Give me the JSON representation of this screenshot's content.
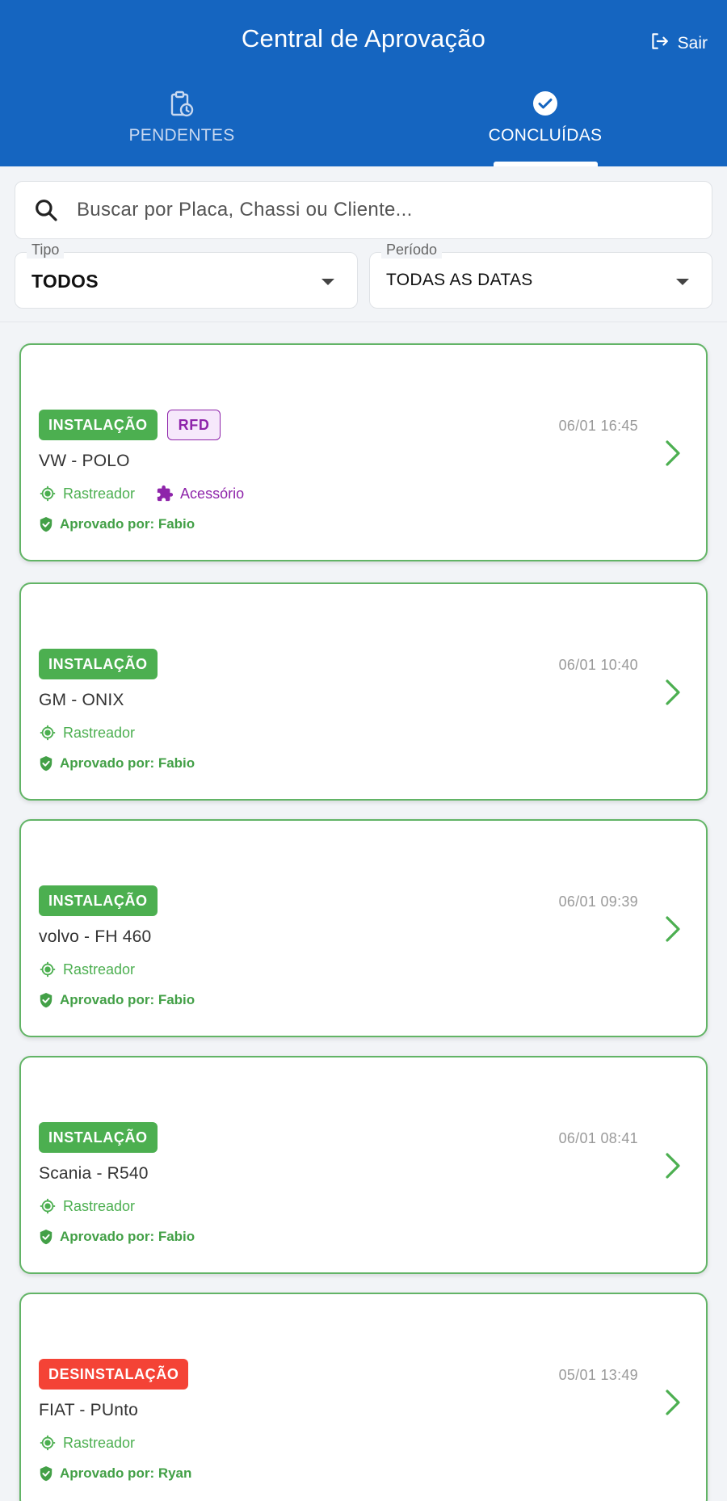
{
  "header": {
    "title": "Central de Aprovação",
    "logout_label": "Sair",
    "accent_color": "#1565c0"
  },
  "tabs": [
    {
      "label": "PENDENTES",
      "icon": "clipboard-clock-icon",
      "active": false
    },
    {
      "label": "CONCLUÍDAS",
      "icon": "check-circle-icon",
      "active": true
    }
  ],
  "search": {
    "placeholder": "Buscar por Placa, Chassi ou Cliente..."
  },
  "filters": {
    "tipo": {
      "label": "Tipo",
      "value": "TODOS"
    },
    "periodo": {
      "label": "Período",
      "value": "TODAS AS DATAS"
    }
  },
  "cards": [
    {
      "type": "INSTALAÇÃO",
      "extra_badge": "RFD",
      "date": "06/01 16:45",
      "vehicle": "VW - POLO",
      "tracker": "Rastreador",
      "accessory": "Acessório",
      "approved": "Aprovado por: Fabio"
    },
    {
      "type": "INSTALAÇÃO",
      "date": "06/01 10:40",
      "vehicle": "GM - ONIX",
      "tracker": "Rastreador",
      "approved": "Aprovado por: Fabio"
    },
    {
      "type": "INSTALAÇÃO",
      "date": "06/01 09:39",
      "vehicle": "volvo - FH 460",
      "tracker": "Rastreador",
      "approved": "Aprovado por: Fabio"
    },
    {
      "type": "INSTALAÇÃO",
      "date": "06/01 08:41",
      "vehicle": "Scania - R540",
      "tracker": "Rastreador",
      "approved": "Aprovado por: Fabio"
    },
    {
      "type": "DESINSTALAÇÃO",
      "date": "05/01 13:49",
      "vehicle": "FIAT - PUnto",
      "tracker": "Rastreador",
      "approved": "Aprovado por: Ryan"
    }
  ],
  "colors": {
    "installation": "#4caf50",
    "uninstallation": "#f44336",
    "accessory": "#8e24aa",
    "approved": "#43a047",
    "card_border": "#62b466"
  }
}
